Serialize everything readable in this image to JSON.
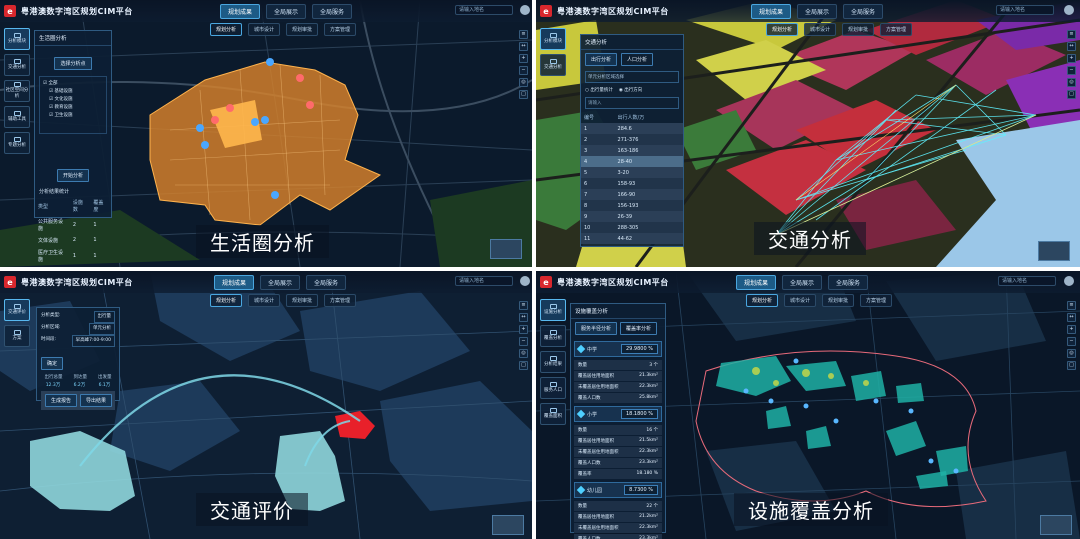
{
  "app_title": "粤港澳数字湾区规划CIM平台",
  "q1": {
    "caption": "生活圈分析",
    "tabs": [
      "规划成果",
      "全局展示",
      "全局服务"
    ],
    "subtabs": [
      "规划分析",
      "城市设计",
      "规划审批",
      "方案管理"
    ],
    "search": "请输入地名",
    "rail": [
      "分析模块",
      "交通分析",
      "社区空间分析",
      "辅助工具",
      "专题分析",
      "结论"
    ],
    "panel": {
      "title": "生活圈分析",
      "start_button": "选择分析点",
      "tree": [
        "全部",
        "基础设施",
        "文化设施",
        "教育设施",
        "卫生设施"
      ],
      "analyze_button": "开始分析",
      "result_title": "分析结果统计",
      "headers": [
        "类型",
        "设施数",
        "覆盖度"
      ],
      "rows": [
        {
          "name": "公共服务设施",
          "count": "2",
          "rate": "1"
        },
        {
          "name": "文体设施",
          "count": "2",
          "rate": "1"
        },
        {
          "name": "医疗卫生设施",
          "count": "1",
          "rate": "1"
        }
      ]
    }
  },
  "q2": {
    "caption": "交通分析",
    "tabs": [
      "规划成果",
      "全局展示",
      "全局服务"
    ],
    "subtabs": [
      "规划分析",
      "城市设计",
      "规划审批",
      "方案管理"
    ],
    "search": "请输入地名",
    "rail": [
      "分析模块",
      "交通分析"
    ],
    "panel": {
      "title": "交通分析",
      "modes": [
        "出行分析",
        "人口分析"
      ],
      "select_placeholder": "单元分析区域选择",
      "radios": [
        "出行量统计",
        "出行方向"
      ],
      "filter_placeholder": "请输入",
      "headers": [
        "编号",
        "出行人数/万"
      ],
      "rows": [
        {
          "id": "1",
          "value": "284.6"
        },
        {
          "id": "2",
          "value": "271-376"
        },
        {
          "id": "3",
          "value": "163-186"
        },
        {
          "id": "4",
          "value": "28-40"
        },
        {
          "id": "5",
          "value": "3-20"
        },
        {
          "id": "6",
          "value": "158-93"
        },
        {
          "id": "7",
          "value": "166-90"
        },
        {
          "id": "8",
          "value": "156-193"
        },
        {
          "id": "9",
          "value": "26-39"
        },
        {
          "id": "10",
          "value": "288-305"
        },
        {
          "id": "11",
          "value": "44-62"
        }
      ],
      "highlight_row": 3
    }
  },
  "q3": {
    "caption": "交通评价",
    "tabs": [
      "规划成果",
      "全局展示",
      "全局服务"
    ],
    "subtabs": [
      "规划分析",
      "城市设计",
      "规划审批",
      "方案管理"
    ],
    "search": "请输入地名",
    "rail": [
      "交通评价",
      "方案"
    ],
    "panel": {
      "fields": [
        {
          "label": "分析类型:",
          "value": "出行量"
        },
        {
          "label": "分析区域:",
          "value": "单元分析"
        },
        {
          "label": "时间段:",
          "value": "早高峰7:00-9:00"
        }
      ],
      "confirm_button": "确定",
      "legend_labels": [
        "出行总量",
        "到达量",
        "出发量"
      ],
      "legend_values": [
        "12.3万",
        "6.2万",
        "6.1万"
      ],
      "actions": [
        "生成报告",
        "导出结果"
      ]
    }
  },
  "q4": {
    "caption": "设施覆盖分析",
    "tabs": [
      "规划成果",
      "全局展示",
      "全局服务"
    ],
    "subtabs": [
      "规划分析",
      "城市设计",
      "规划审批",
      "方案管理"
    ],
    "search": "请输入地名",
    "rail": [
      "设施分析",
      "覆盖分析",
      "分析结果",
      "服务人口",
      "覆盖面积"
    ],
    "panel": {
      "title": "设施覆盖分析",
      "toggle": [
        "服务半径分析",
        "覆盖率分析"
      ],
      "groups": [
        {
          "name": "中学",
          "percent": "29.9800 %",
          "rows": [
            {
              "k": "数量",
              "v": "3 个"
            },
            {
              "k": "覆盖居住用地面积",
              "v": "21.3km²"
            },
            {
              "k": "未覆盖居住用地面积",
              "v": "22.3km²"
            },
            {
              "k": "覆盖人口数",
              "v": "25.8km²"
            }
          ]
        },
        {
          "name": "小学",
          "percent": "18.1800 %",
          "rows": [
            {
              "k": "数量",
              "v": "16 个"
            },
            {
              "k": "覆盖居住用地面积",
              "v": "21.5km²"
            },
            {
              "k": "未覆盖居住用地面积",
              "v": "22.3km²"
            },
            {
              "k": "覆盖人口数",
              "v": "23.3km²"
            },
            {
              "k": "覆盖率",
              "v": "18.180 %"
            }
          ]
        },
        {
          "name": "幼儿园",
          "percent": "8.7300 %",
          "rows": [
            {
              "k": "数量",
              "v": "22 个"
            },
            {
              "k": "覆盖居住用地面积",
              "v": "21.2km²"
            },
            {
              "k": "未覆盖居住用地面积",
              "v": "22.3km²"
            },
            {
              "k": "覆盖人口数",
              "v": "23.3km²"
            },
            {
              "k": "覆盖率",
              "v": "8.730 %"
            }
          ]
        }
      ]
    }
  },
  "colors": {
    "accent": "#4aa7e0",
    "logo": "#d8272d",
    "panel": "#0d1f34"
  }
}
